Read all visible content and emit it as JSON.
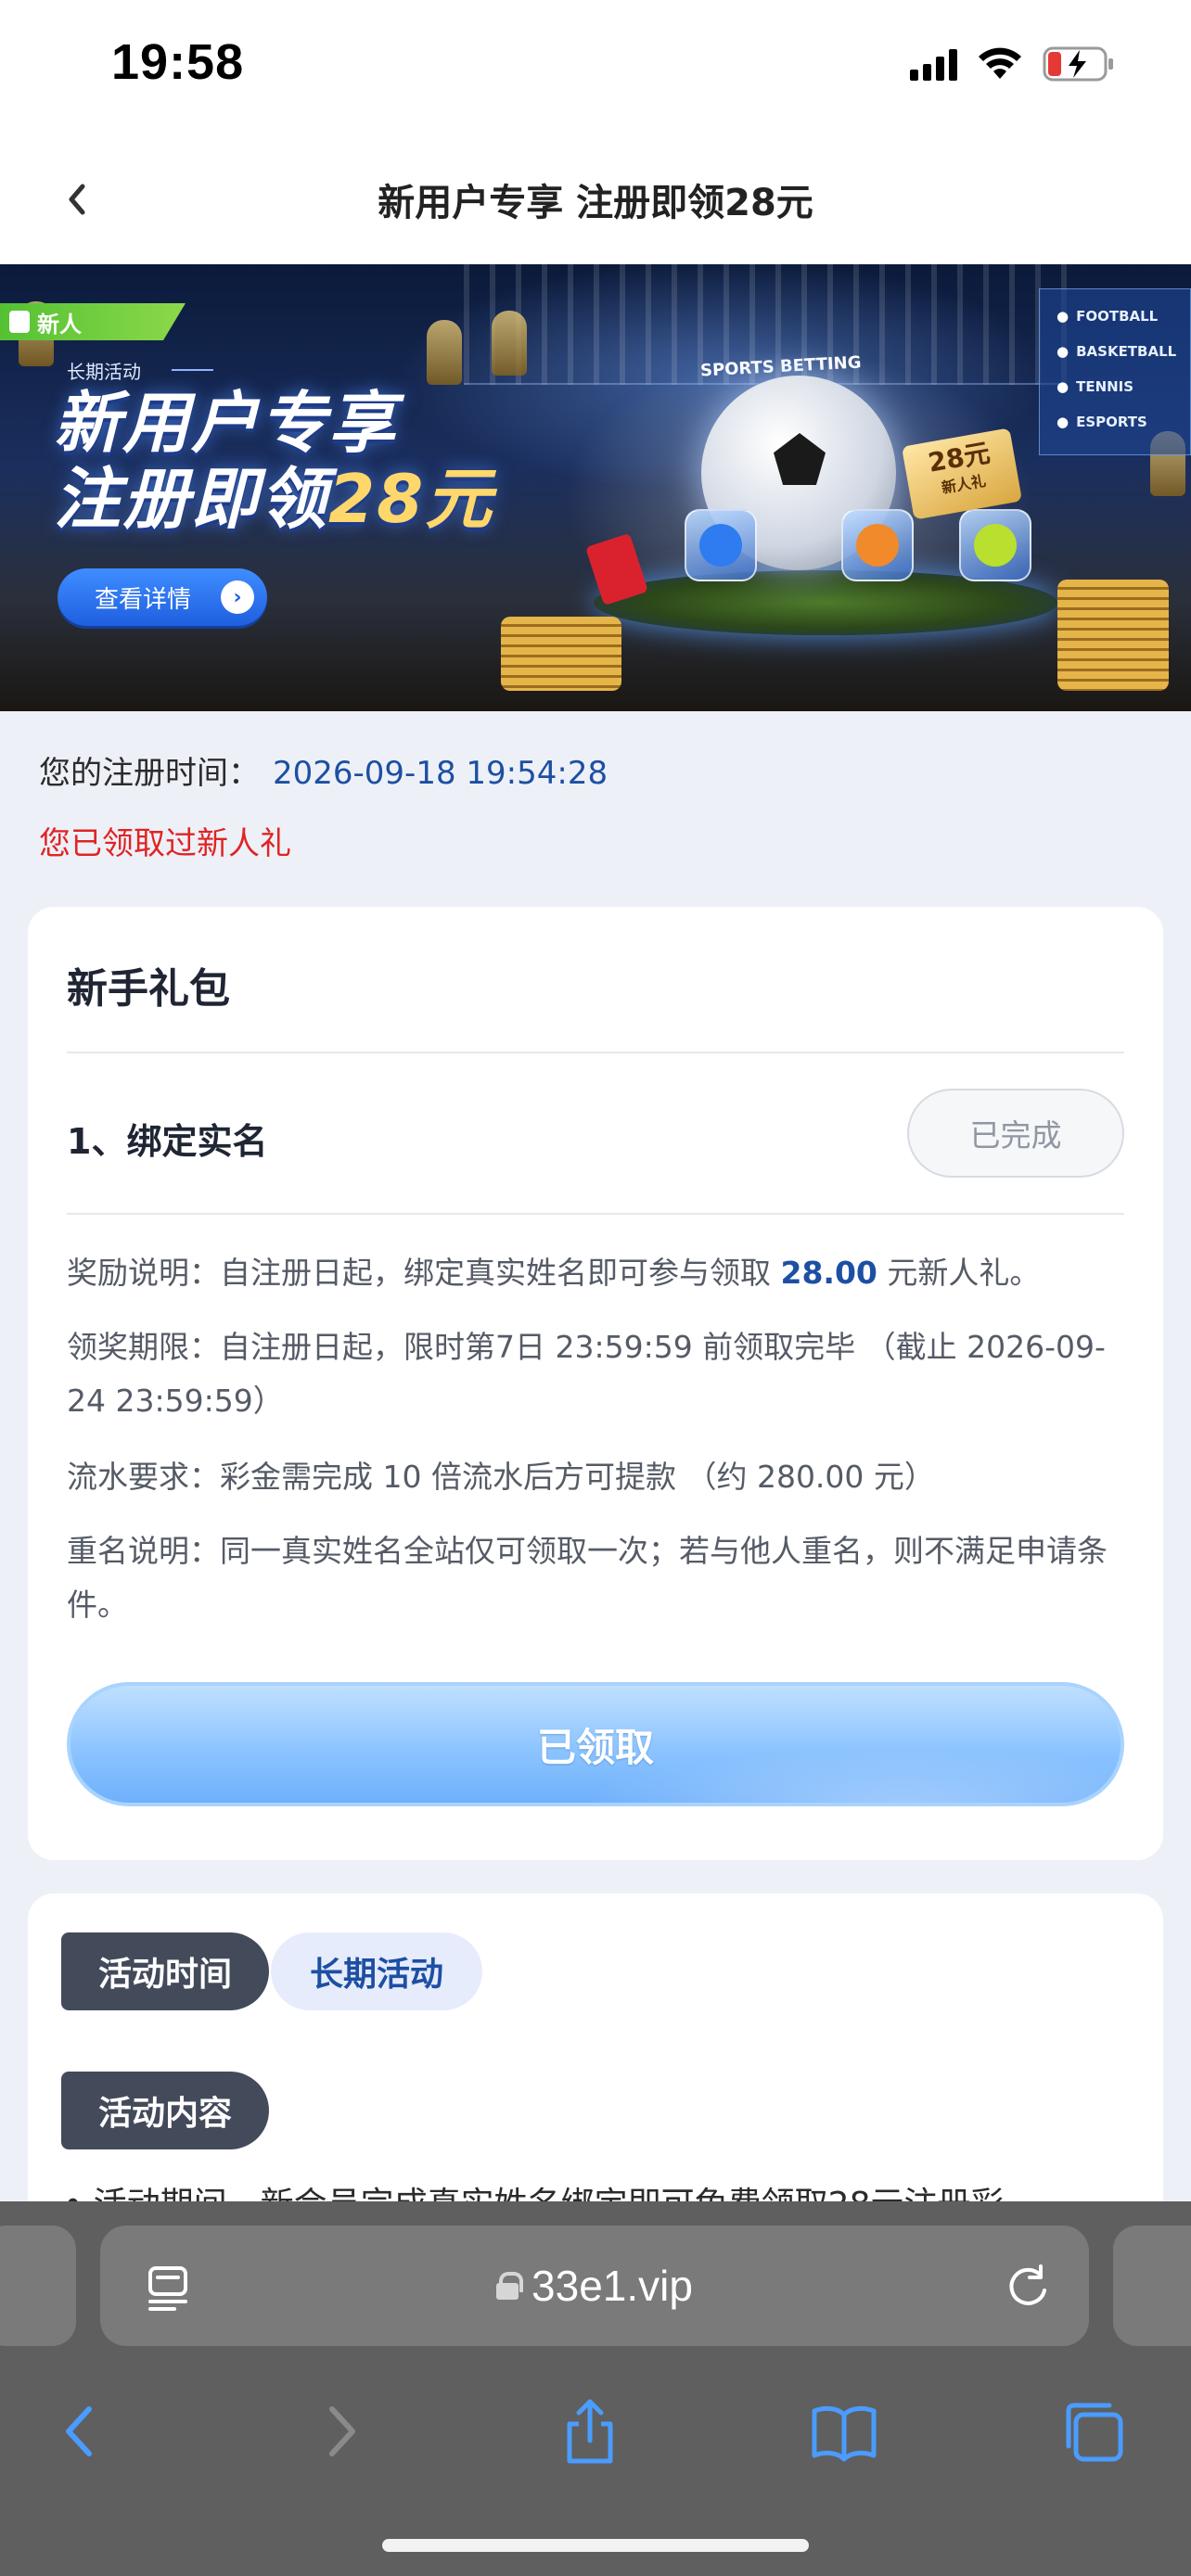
{
  "status_bar": {
    "time": "19:58",
    "icons": [
      "cellular-signal-icon",
      "wifi-icon",
      "battery-charging-icon"
    ],
    "battery_color": "#e53935"
  },
  "nav": {
    "back_icon": "chevron-left-icon",
    "title": "新用户专享 注册即领28元"
  },
  "banner": {
    "tag": "新人",
    "subtitle": "长期活动",
    "headline_line1": "新用户专享",
    "headline_line2_prefix": "注册即领",
    "headline_line2_amount": "28元",
    "detail_button": "查看详情",
    "sports_betting": "SPORTS BETTING",
    "sports": [
      "FOOTBALL",
      "BASKETBALL",
      "TENNIS",
      "ESPORTS"
    ],
    "gift_card_amount": "28元",
    "gift_card_label": "新人礼"
  },
  "registration": {
    "label": "您的注册时间：",
    "time": "2026-09-18 19:54:28",
    "notice": "您已领取过新人礼"
  },
  "gift_pack": {
    "title": "新手礼包",
    "task": {
      "title": "1、绑定实名",
      "status": "已完成"
    },
    "rules": {
      "reward_prefix": "奖励说明：自注册日起，绑定真实姓名即可参与领取 ",
      "reward_amount": "28.00",
      "reward_suffix": " 元新人礼。",
      "deadline": "领奖期限：自注册日起，限时第7日 23:59:59 前领取完毕 （截止 2026-09-24 23:59:59）",
      "turnover": "流水要求：彩金需完成 10 倍流水后方可提款 （约 280.00 元）",
      "duplicate_name": "重名说明：同一真实姓名全站仅可领取一次；若与他人重名，则不满足申请条件。"
    },
    "claimed_button": "已领取"
  },
  "activity": {
    "time_label": "活动时间",
    "time_value": "长期活动",
    "content_label": "活动内容",
    "content_partial": "•  活动期间，新会员完成真实姓名绑定即可免费领取28元注册彩"
  },
  "browser": {
    "url": "33e1.vip",
    "address_icons": [
      "reader-mode-icon",
      "lock-icon",
      "reload-icon"
    ],
    "toolbar_icons": [
      "back-icon",
      "forward-icon",
      "share-icon",
      "bookmarks-icon",
      "tabs-icon"
    ],
    "accent_color": "#4a9cff"
  }
}
